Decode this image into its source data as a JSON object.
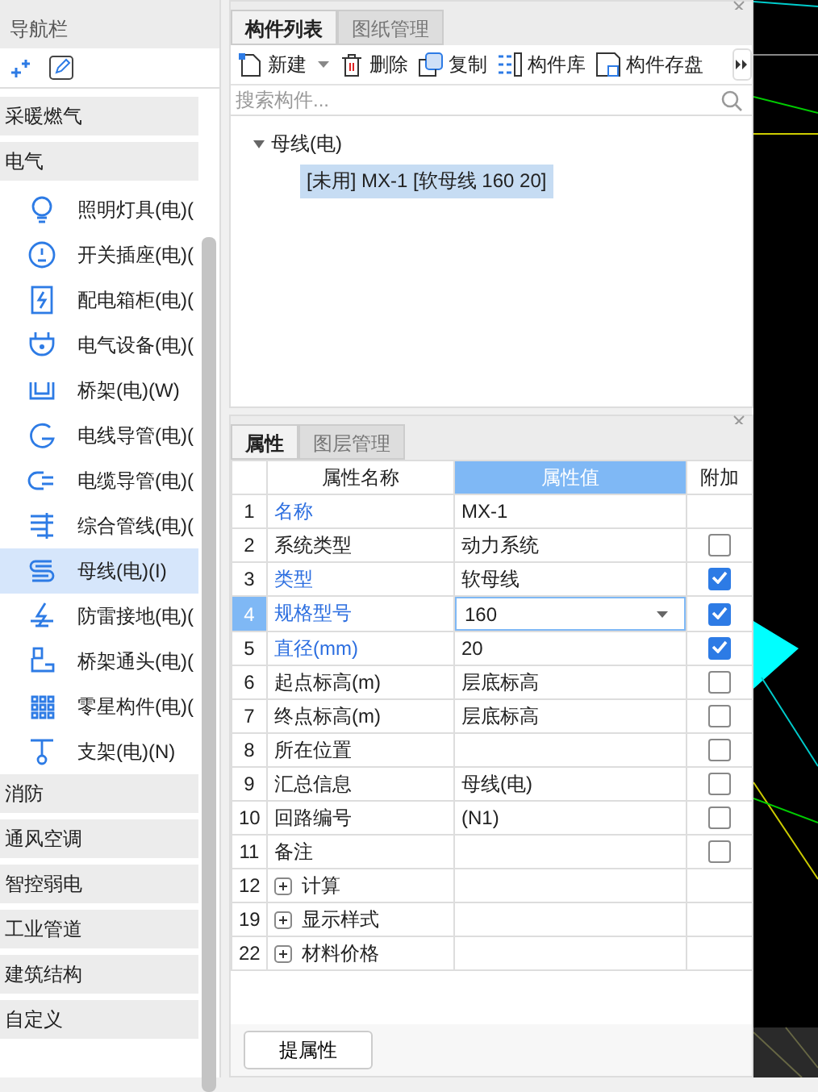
{
  "nav": {
    "title": "导航栏",
    "categories": [
      {
        "label": "采暖燃气"
      },
      {
        "label": "电气",
        "items": [
          {
            "label": "照明灯具(电)(",
            "selected": false
          },
          {
            "label": "开关插座(电)(",
            "selected": false
          },
          {
            "label": "配电箱柜(电)(",
            "selected": false
          },
          {
            "label": "电气设备(电)(",
            "selected": false
          },
          {
            "label": "桥架(电)(W)",
            "selected": false
          },
          {
            "label": "电线导管(电)(",
            "selected": false
          },
          {
            "label": "电缆导管(电)(",
            "selected": false
          },
          {
            "label": "综合管线(电)(",
            "selected": false
          },
          {
            "label": "母线(电)(I)",
            "selected": true
          },
          {
            "label": "防雷接地(电)(",
            "selected": false
          },
          {
            "label": "桥架通头(电)(",
            "selected": false
          },
          {
            "label": "零星构件(电)(",
            "selected": false
          },
          {
            "label": "支架(电)(N)",
            "selected": false
          }
        ]
      },
      {
        "label": "消防"
      },
      {
        "label": "通风空调"
      },
      {
        "label": "智控弱电"
      },
      {
        "label": "工业管道"
      },
      {
        "label": "建筑结构"
      },
      {
        "label": "自定义"
      }
    ]
  },
  "components": {
    "tabs": [
      {
        "label": "构件列表",
        "selected": true
      },
      {
        "label": "图纸管理",
        "selected": false
      }
    ],
    "toolbar": [
      {
        "label": "新建",
        "dropdown": true
      },
      {
        "label": "删除"
      },
      {
        "label": "复制"
      },
      {
        "label": "构件库"
      },
      {
        "label": "构件存盘"
      }
    ],
    "search": {
      "placeholder": "搜索构件..."
    },
    "tree": [
      {
        "label": "母线(电)",
        "expanded": true,
        "children": [
          {
            "label": "[未用] MX-1 [软母线 160 20]",
            "selected": true
          }
        ]
      }
    ]
  },
  "properties": {
    "tabs": [
      {
        "label": "属性",
        "selected": true
      },
      {
        "label": "图层管理",
        "selected": false
      }
    ],
    "columns": [
      "属性名称",
      "属性值",
      "附加"
    ],
    "rows": [
      {
        "kind": "prop",
        "num": "1",
        "name": "名称",
        "value": "MX-1",
        "key": true,
        "selected": false
      },
      {
        "kind": "prop",
        "num": "2",
        "name": "系统类型",
        "value": "动力系统",
        "key": false,
        "selected": false,
        "checked": false
      },
      {
        "kind": "prop",
        "num": "3",
        "name": "类型",
        "value": "软母线",
        "key": true,
        "selected": false,
        "checked": true
      },
      {
        "kind": "prop",
        "num": "4",
        "name": "规格型号",
        "value": "160",
        "key": true,
        "selected": true,
        "checked": true
      },
      {
        "kind": "prop",
        "num": "5",
        "name": "直径(mm)",
        "value": "20",
        "key": true,
        "selected": false,
        "checked": true
      },
      {
        "kind": "prop",
        "num": "6",
        "name": "起点标高(m)",
        "value": "层底标高",
        "key": false,
        "selected": false,
        "checked": false
      },
      {
        "kind": "prop",
        "num": "7",
        "name": "终点标高(m)",
        "value": "层底标高",
        "key": false,
        "selected": false,
        "checked": false
      },
      {
        "kind": "prop",
        "num": "8",
        "name": "所在位置",
        "key": false,
        "selected": false,
        "checked": false
      },
      {
        "kind": "prop",
        "num": "9",
        "name": "汇总信息",
        "value": "母线(电)",
        "key": false,
        "selected": false,
        "checked": false
      },
      {
        "kind": "prop",
        "num": "10",
        "name": "回路编号",
        "value": "(N1)",
        "key": false,
        "selected": false,
        "checked": false
      },
      {
        "kind": "prop",
        "num": "11",
        "name": "备注",
        "key": false,
        "selected": false,
        "checked": false
      },
      {
        "kind": "group",
        "num": "12",
        "name": "计算",
        "expanded": false
      },
      {
        "kind": "group",
        "num": "19",
        "name": "显示样式",
        "expanded": false
      },
      {
        "kind": "group",
        "num": "22",
        "name": "材料价格",
        "expanded": false
      }
    ],
    "button": "提属性"
  }
}
